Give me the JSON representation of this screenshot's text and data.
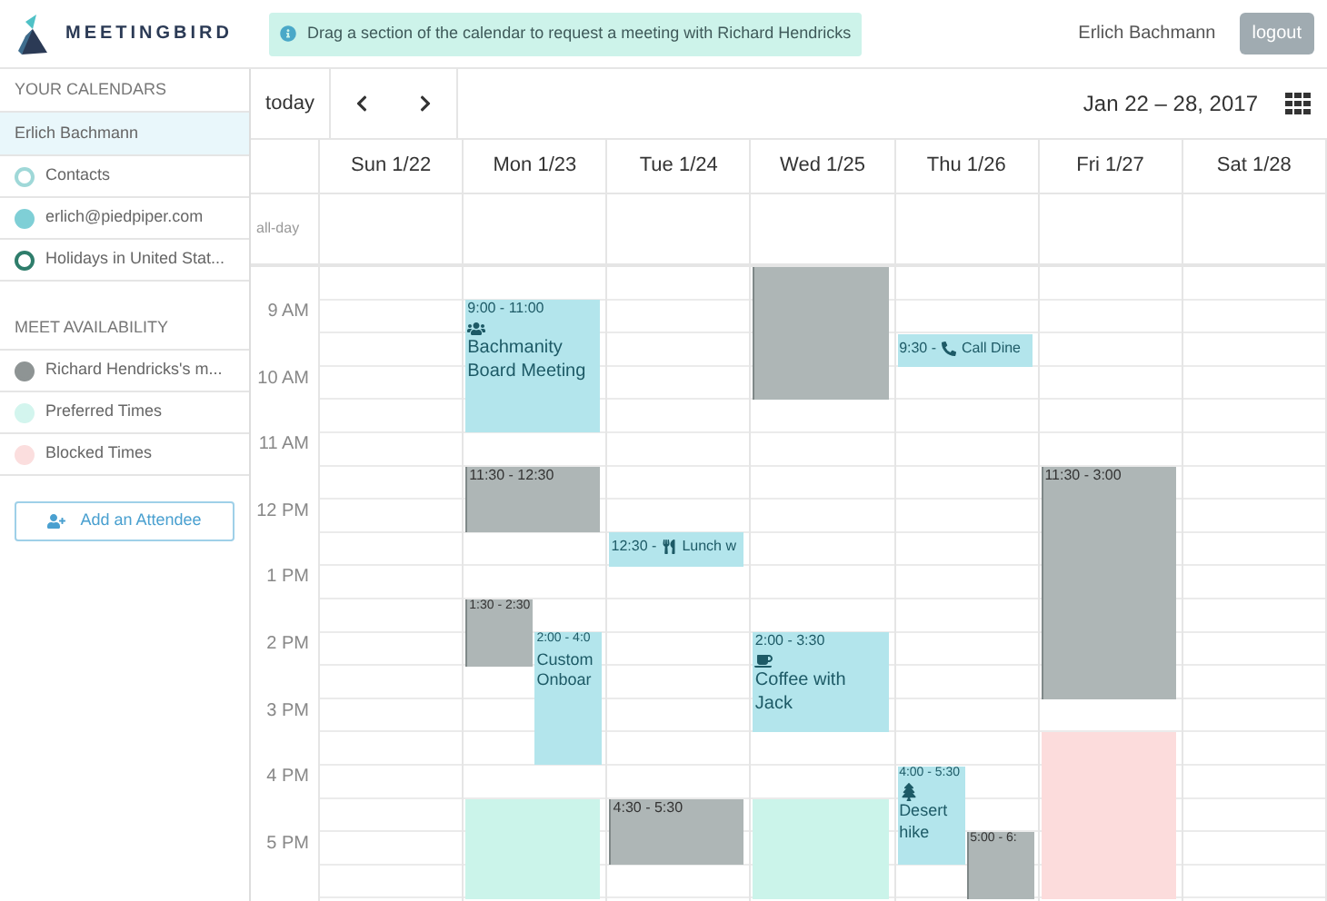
{
  "app": {
    "name": "MEETINGBIRD"
  },
  "banner": {
    "text": "Drag a section of the calendar to request a meeting with Richard Hendricks"
  },
  "user": {
    "name": "Erlich Bachmann"
  },
  "logout": "logout",
  "sidebar": {
    "calendars": {
      "title": "YOUR CALENDARS",
      "owner": "Erlich Bachmann",
      "items": [
        {
          "label": "Contacts",
          "color": "#9fd8d8",
          "filled": false
        },
        {
          "label": "erlich@piedpiper.com",
          "color": "#7fcfd6",
          "filled": true
        },
        {
          "label": "Holidays in United Stat...",
          "color": "#2e7d6b",
          "filled": false
        }
      ]
    },
    "availability": {
      "title": "MEET AVAILABILITY",
      "items": [
        {
          "label": "Richard Hendricks's m...",
          "color": "#8e9494"
        },
        {
          "label": "Preferred Times",
          "color": "#d3f5ee"
        },
        {
          "label": "Blocked Times",
          "color": "#fbdede"
        }
      ]
    },
    "add_button": "Add an Attendee"
  },
  "toolbar": {
    "today": "today",
    "range": "Jan 22 – 28, 2017"
  },
  "all_day_label": "all-day",
  "hours": [
    "9 AM",
    "10 AM",
    "11 AM",
    "12 PM",
    "1 PM",
    "2 PM",
    "3 PM",
    "4 PM",
    "5 PM"
  ],
  "days": [
    {
      "label": "Sun 1/22"
    },
    {
      "label": "Mon 1/23",
      "events": [
        {
          "kind": "meeting",
          "time": "9:00 - 11:00",
          "title": "Bachmanity Board Meeting"
        },
        {
          "kind": "busy",
          "time": "11:30 - 12:30"
        },
        {
          "kind": "busy",
          "time": "1:30 - 2:30"
        },
        {
          "kind": "meeting",
          "time": "2:00 - 4:0",
          "title": "Custom Onboar"
        },
        {
          "kind": "preferred"
        }
      ]
    },
    {
      "label": "Tue 1/24",
      "events": [
        {
          "kind": "meeting",
          "time": "12:30 -",
          "title": "Lunch w"
        },
        {
          "kind": "busy",
          "time": "4:30 - 5:30"
        }
      ]
    },
    {
      "label": "Wed 1/25",
      "events": [
        {
          "kind": "busy"
        },
        {
          "kind": "meeting",
          "time": "2:00 - 3:30",
          "title": "Coffee with Jack"
        },
        {
          "kind": "preferred"
        }
      ]
    },
    {
      "label": "Thu 1/26",
      "events": [
        {
          "kind": "meeting",
          "time": "9:30 -",
          "title": "Call Dine"
        },
        {
          "kind": "meeting",
          "time": "4:00 - 5:30",
          "title": "Desert hike"
        },
        {
          "kind": "busy",
          "time": "5:00 - 6:"
        }
      ]
    },
    {
      "label": "Fri 1/27",
      "events": [
        {
          "kind": "busy",
          "time": "11:30 - 3:00"
        },
        {
          "kind": "blocked"
        }
      ]
    },
    {
      "label": "Sat 1/28"
    }
  ]
}
